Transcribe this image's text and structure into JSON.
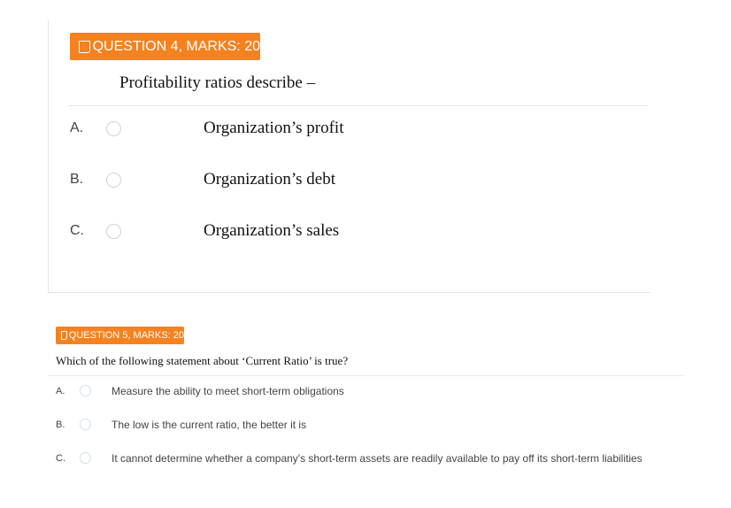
{
  "question4": {
    "badge": "QUESTION 4, MARKS: 20",
    "stem": "Profitability ratios describe –",
    "options": [
      {
        "letter": "A.",
        "text": "Organization’s profit"
      },
      {
        "letter": "B.",
        "text": "Organization’s debt"
      },
      {
        "letter": "C.",
        "text": "Organization’s sales"
      }
    ]
  },
  "question5": {
    "badge": "QUESTION 5, MARKS: 20",
    "stem": "Which of the following statement about ‘Current Ratio’ is true?",
    "options": [
      {
        "letter": "A.",
        "text": "Measure the ability to meet short-term obligations"
      },
      {
        "letter": "B.",
        "text": "The low is the current ratio, the better it is"
      },
      {
        "letter": "C.",
        "text": "It cannot determine whether a company's short-term assets are readily available to pay off its short-term liabilities"
      }
    ]
  },
  "colors": {
    "accent": "#f58220",
    "radio_border": "#c9d3e0"
  },
  "icons": {
    "badge_icon": "note-icon"
  }
}
